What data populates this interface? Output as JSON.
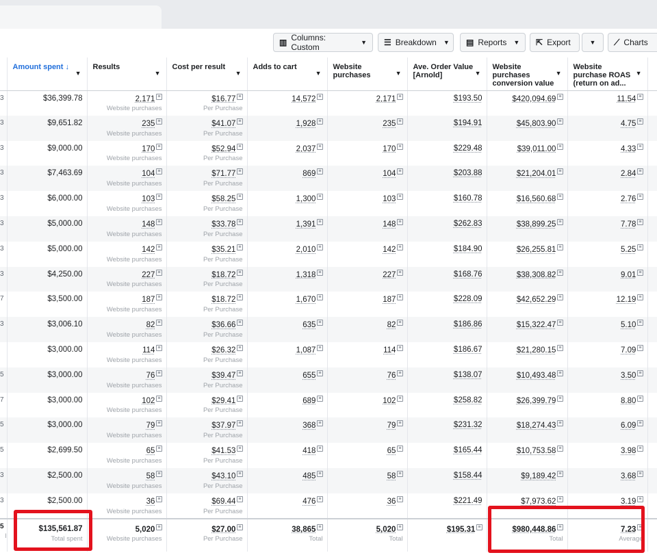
{
  "toolbar": {
    "columns": "Columns: Custom",
    "breakdown": "Breakdown",
    "reports": "Reports",
    "export": "Export",
    "charts": "Charts"
  },
  "headers": [
    "Amount spent ↓",
    "Results",
    "Cost per result",
    "Adds to cart",
    "Website purchases",
    "Ave. Order Value [Arnold]",
    "Website purchases conversion value",
    "Website purchase ROAS (return on ad..."
  ],
  "result_sub": "Website purchases",
  "cost_sub": "Per Purchase",
  "rows": [
    {
      "edge": "3",
      "spent": "$36,399.78",
      "results": "2,171",
      "cost": "$16.77",
      "carts": "14,572",
      "purch": "2,171",
      "aov": "$193.50",
      "value": "$420,094.69",
      "roas": "11.54"
    },
    {
      "edge": "3",
      "spent": "$9,651.82",
      "results": "235",
      "cost": "$41.07",
      "carts": "1,928",
      "purch": "235",
      "aov": "$194.91",
      "value": "$45,803.90",
      "roas": "4.75"
    },
    {
      "edge": "3",
      "spent": "$9,000.00",
      "results": "170",
      "cost": "$52.94",
      "carts": "2,037",
      "purch": "170",
      "aov": "$229.48",
      "value": "$39,011.00",
      "roas": "4.33"
    },
    {
      "edge": "3",
      "spent": "$7,463.69",
      "results": "104",
      "cost": "$71.77",
      "carts": "869",
      "purch": "104",
      "aov": "$203.88",
      "value": "$21,204.01",
      "roas": "2.84"
    },
    {
      "edge": "3",
      "spent": "$6,000.00",
      "results": "103",
      "cost": "$58.25",
      "carts": "1,300",
      "purch": "103",
      "aov": "$160.78",
      "value": "$16,560.68",
      "roas": "2.76"
    },
    {
      "edge": "3",
      "spent": "$5,000.00",
      "results": "148",
      "cost": "$33.78",
      "carts": "1,391",
      "purch": "148",
      "aov": "$262.83",
      "value": "$38,899.25",
      "roas": "7.78"
    },
    {
      "edge": "3",
      "spent": "$5,000.00",
      "results": "142",
      "cost": "$35.21",
      "carts": "2,010",
      "purch": "142",
      "aov": "$184.90",
      "value": "$26,255.81",
      "roas": "5.25"
    },
    {
      "edge": "3",
      "spent": "$4,250.00",
      "results": "227",
      "cost": "$18.72",
      "carts": "1,318",
      "purch": "227",
      "aov": "$168.76",
      "value": "$38,308.82",
      "roas": "9.01"
    },
    {
      "edge": "7",
      "spent": "$3,500.00",
      "results": "187",
      "cost": "$18.72",
      "carts": "1,670",
      "purch": "187",
      "aov": "$228.09",
      "value": "$42,652.29",
      "roas": "12.19"
    },
    {
      "edge": "3",
      "spent": "$3,006.10",
      "results": "82",
      "cost": "$36.66",
      "carts": "635",
      "purch": "82",
      "aov": "$186.86",
      "value": "$15,322.47",
      "roas": "5.10"
    },
    {
      "edge": "",
      "spent": "$3,000.00",
      "results": "114",
      "cost": "$26.32",
      "carts": "1,087",
      "purch": "114",
      "aov": "$186.67",
      "value": "$21,280.15",
      "roas": "7.09"
    },
    {
      "edge": "5",
      "spent": "$3,000.00",
      "results": "76",
      "cost": "$39.47",
      "carts": "655",
      "purch": "76",
      "aov": "$138.07",
      "value": "$10,493.48",
      "roas": "3.50"
    },
    {
      "edge": "7",
      "spent": "$3,000.00",
      "results": "102",
      "cost": "$29.41",
      "carts": "689",
      "purch": "102",
      "aov": "$258.82",
      "value": "$26,399.79",
      "roas": "8.80"
    },
    {
      "edge": "5",
      "spent": "$3,000.00",
      "results": "79",
      "cost": "$37.97",
      "carts": "368",
      "purch": "79",
      "aov": "$231.32",
      "value": "$18,274.43",
      "roas": "6.09"
    },
    {
      "edge": "5",
      "spent": "$2,699.50",
      "results": "65",
      "cost": "$41.53",
      "carts": "418",
      "purch": "65",
      "aov": "$165.44",
      "value": "$10,753.58",
      "roas": "3.98"
    },
    {
      "edge": "3",
      "spent": "$2,500.00",
      "results": "58",
      "cost": "$43.10",
      "carts": "485",
      "purch": "58",
      "aov": "$158.44",
      "value": "$9,189.42",
      "roas": "3.68"
    },
    {
      "edge": "3",
      "spent": "$2,500.00",
      "results": "36",
      "cost": "$69.44",
      "carts": "476",
      "purch": "36",
      "aov": "$221.49",
      "value": "$7,973.62",
      "roas": "3.19"
    }
  ],
  "totals": {
    "edge": "5",
    "edge_sub": "l",
    "spent": "$135,561.87",
    "spent_sub": "Total spent",
    "results": "5,020",
    "results_sub": "Website purchases",
    "cost": "$27.00",
    "cost_sub": "Per Purchase",
    "carts": "38,865",
    "carts_sub": "Total",
    "purch": "5,020",
    "purch_sub": "Total",
    "aov": "$195.31",
    "value": "$980,448.86",
    "value_sub": "Total",
    "roas": "7.23",
    "roas_sub": "Average"
  },
  "colors": {
    "sort_accent": "#216fdb",
    "highlight": "#e3121d"
  }
}
